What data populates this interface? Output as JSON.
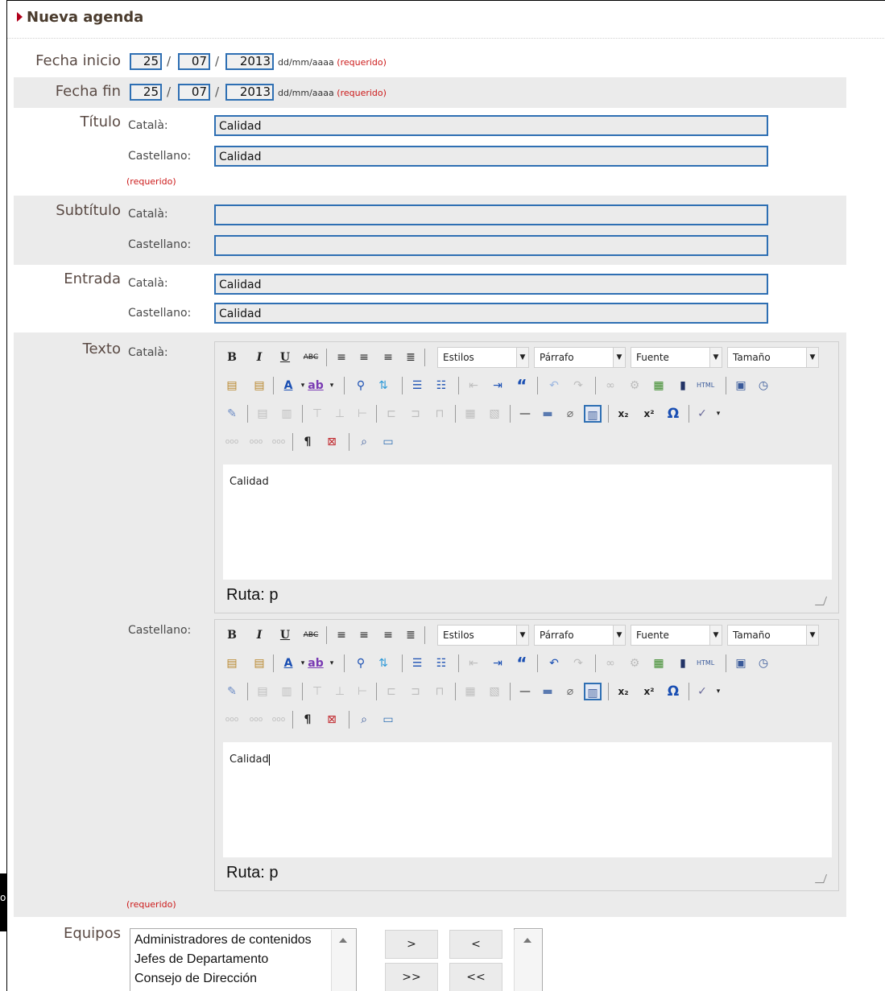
{
  "page": {
    "title": "Nueva agenda",
    "left_fragment": "o"
  },
  "fecha_inicio": {
    "label": "Fecha inicio",
    "day": "25",
    "month": "07",
    "year": "2013",
    "format": "dd/mm/aaaa",
    "required": "(requerido)"
  },
  "fecha_fin": {
    "label": "Fecha fin",
    "day": "25",
    "month": "07",
    "year": "2013",
    "format": "dd/mm/aaaa",
    "required": "(requerido)"
  },
  "titulo": {
    "label": "Título",
    "catala_label": "Català:",
    "castellano_label": "Castellano:",
    "catala_value": "Calidad",
    "castellano_value": "Calidad",
    "required": "(requerido)"
  },
  "subtitulo": {
    "label": "Subtítulo",
    "catala_label": "Català:",
    "castellano_label": "Castellano:",
    "catala_value": "",
    "castellano_value": ""
  },
  "entrada": {
    "label": "Entrada",
    "catala_label": "Català:",
    "castellano_label": "Castellano:",
    "catala_value": "Calidad",
    "castellano_value": "Calidad"
  },
  "texto": {
    "label": "Texto",
    "catala_label": "Català:",
    "castellano_label": "Castellano:",
    "required": "(requerido)",
    "toolbar": {
      "bold": "B",
      "italic": "I",
      "underline": "U",
      "strike": "ABC",
      "styles": "Estilos",
      "paragraph": "Párrafo",
      "font": "Fuente",
      "size": "Tamaño",
      "quote": "“",
      "subscript": "x₂",
      "superscript": "x²",
      "omega": "Ω",
      "pilcrow": "¶"
    },
    "editor_catala": {
      "content": "Calidad",
      "path": "Ruta: p"
    },
    "editor_castellano": {
      "content": "Calidad",
      "path": "Ruta: p"
    }
  },
  "equipos": {
    "label": "Equipos",
    "options": [
      "Administradores de contenidos",
      "Jefes de Departamento",
      "Consejo de Dirección"
    ],
    "btn_add": ">",
    "btn_remove": "<",
    "btn_add_all": ">>",
    "btn_remove_all": "<<"
  },
  "colors": {
    "accent": "#b0001b",
    "input_border": "#2e6fb3",
    "required": "#cc1a1a",
    "row_gray": "#ebebeb"
  }
}
